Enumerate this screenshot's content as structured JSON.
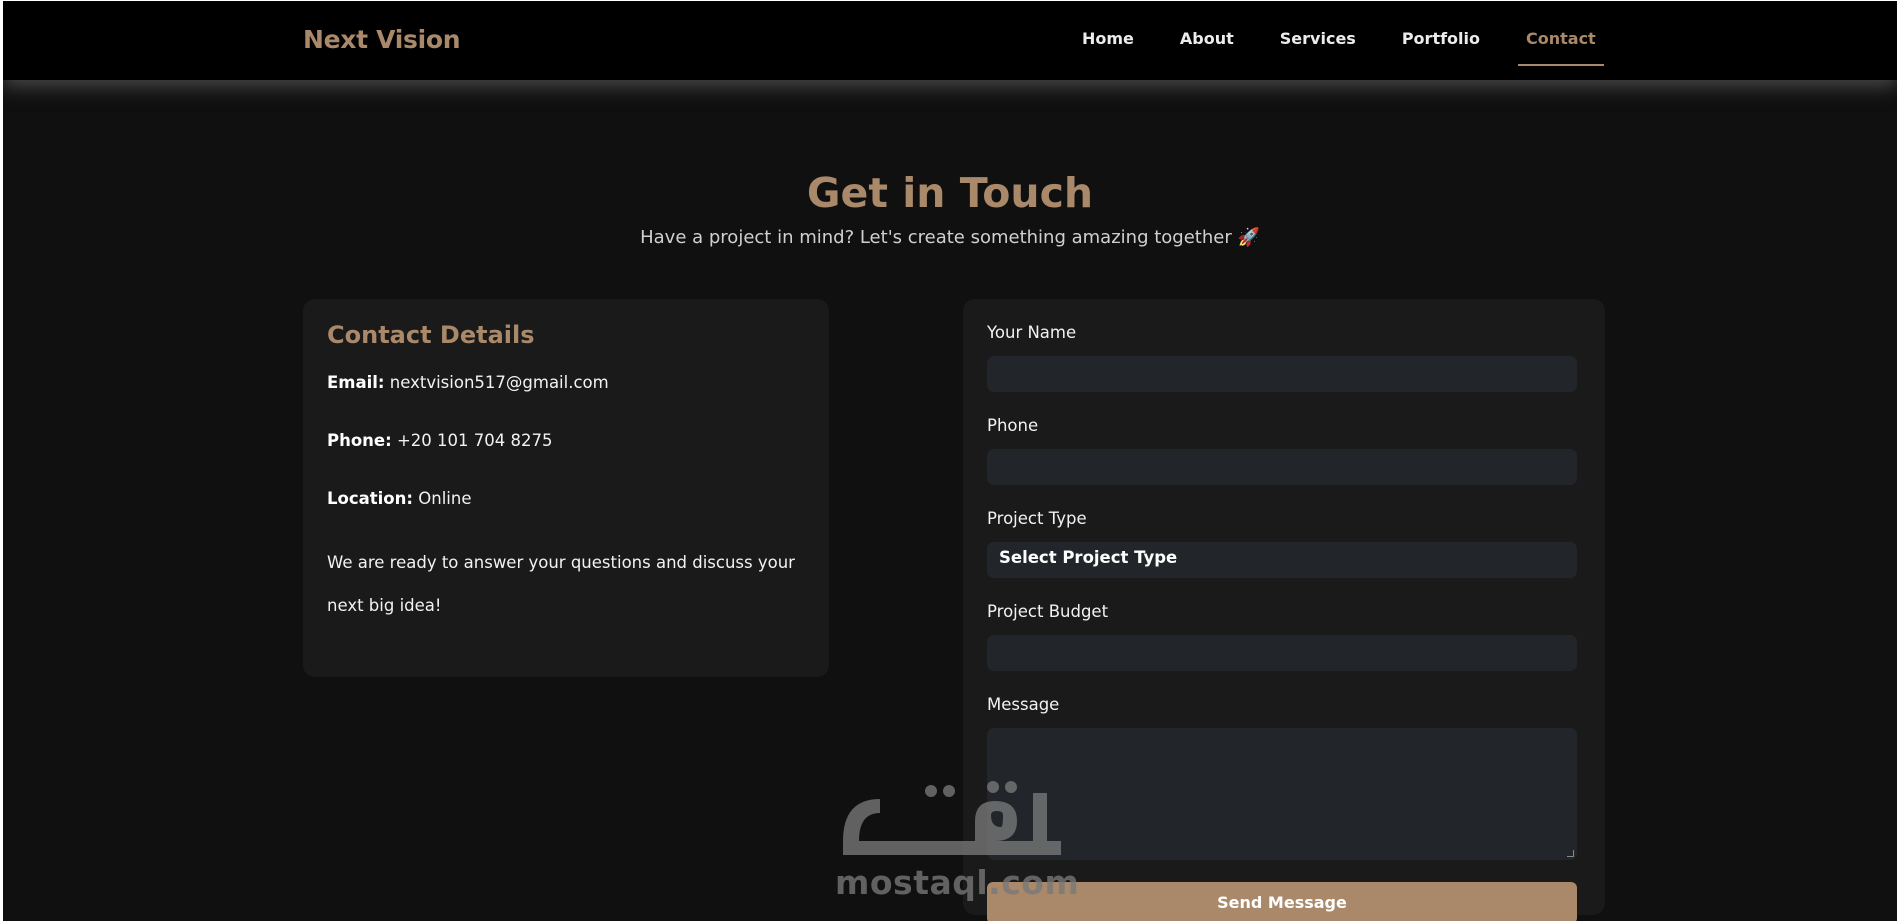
{
  "header": {
    "brand": "Next Vision",
    "nav": [
      "Home",
      "About",
      "Services",
      "Portfolio",
      "Contact"
    ],
    "active_nav": "Contact"
  },
  "hero": {
    "title": "Get in Touch",
    "subtitle": "Have a project in mind? Let's create something amazing together",
    "subtitle_emoji": "🚀"
  },
  "contact_details": {
    "title": "Contact Details",
    "email_label": "Email:",
    "email": "nextvision517@gmail.com",
    "phone_label": "Phone:",
    "phone": "+20 101 704 8275",
    "location_label": "Location:",
    "location": "Online",
    "note": "We are ready to answer your questions and discuss your next big idea!"
  },
  "form": {
    "name_label": "Your Name",
    "name_value": "",
    "phone_label": "Phone",
    "phone_value": "",
    "project_type_label": "Project Type",
    "project_type_selected": "Select Project Type",
    "budget_label": "Project Budget",
    "budget_value": "",
    "message_label": "Message",
    "message_value": "",
    "submit_label": "Send Message"
  },
  "watermark": {
    "arabic": "مستقل",
    "latin": "mostaql.com"
  },
  "colors": {
    "accent": "#a9896a",
    "page_bg": "#101010",
    "card_bg": "#1a1a1a",
    "field_bg": "#22262a",
    "nav_bg": "#000000"
  }
}
